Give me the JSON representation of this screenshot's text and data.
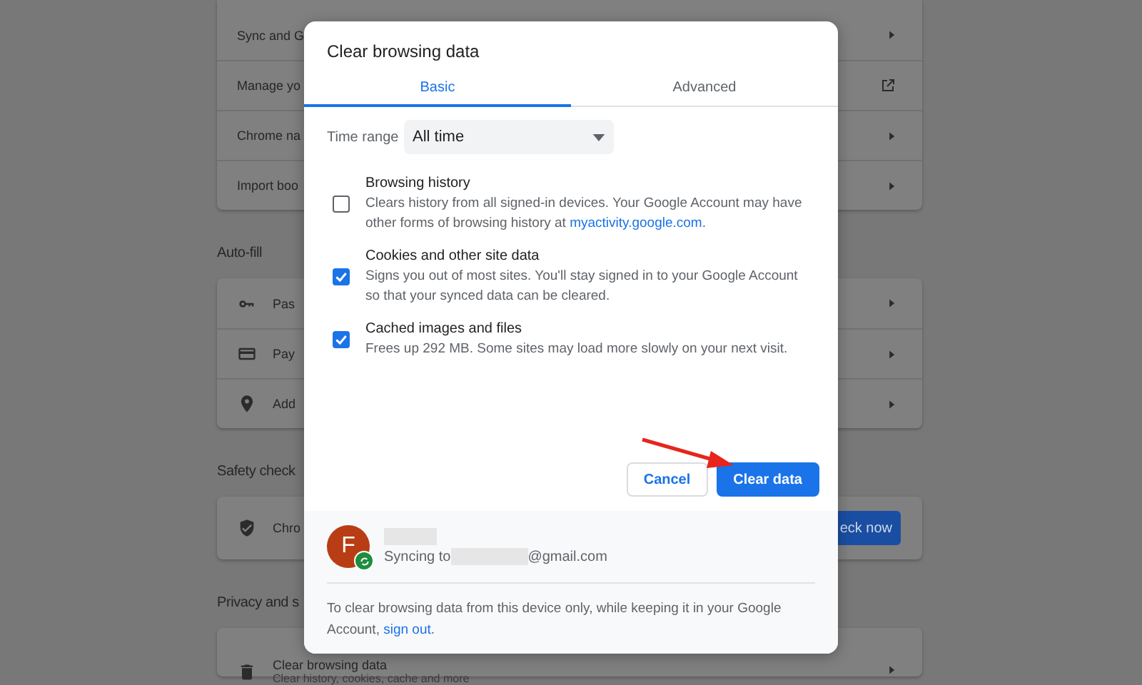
{
  "settings_page": {
    "sections": [
      {
        "rows": [
          {
            "label": "Sync and G"
          },
          {
            "label": "Manage yo"
          },
          {
            "label": "Chrome na"
          },
          {
            "label": "Import boo"
          }
        ]
      },
      {
        "heading": "Auto-fill",
        "rows": [
          {
            "label": "Pas"
          },
          {
            "label": "Pay"
          },
          {
            "label": "Add"
          }
        ]
      },
      {
        "heading": "Safety check",
        "rows": [
          {
            "label": "Chro",
            "button": "eck now"
          }
        ]
      },
      {
        "heading": "Privacy and s",
        "rows": [
          {
            "label": "Clear browsing data",
            "sublabel": "Clear history, cookies, cache and more"
          }
        ]
      }
    ]
  },
  "dialog": {
    "title": "Clear browsing data",
    "tabs": [
      {
        "label": "Basic",
        "selected": true
      },
      {
        "label": "Advanced",
        "selected": false
      }
    ],
    "time_range": {
      "label": "Time range",
      "value": "All time"
    },
    "options": [
      {
        "title": "Browsing history",
        "checked": false,
        "description": "Clears history from all signed-in devices. Your Google Account may have other forms of browsing history at ",
        "link": "myactivity.google.com",
        "description_end": "."
      },
      {
        "title": "Cookies and other site data",
        "checked": true,
        "description": "Signs you out of most sites. You'll stay signed in to your Google Account so that your synced data can be cleared."
      },
      {
        "title": "Cached images and files",
        "checked": true,
        "description": "Frees up 292 MB. Some sites may load more slowly on your next visit."
      }
    ],
    "buttons": [
      {
        "label": "Cancel",
        "kind": "secondary"
      },
      {
        "label": "Clear data",
        "kind": "primary"
      }
    ],
    "account": {
      "avatar_letter": "F",
      "sync_prefix": "Syncing to",
      "email_suffix": "@gmail.com"
    },
    "footer_note": {
      "text": "To clear browsing data from this device only, while keeping it in your Google Account, ",
      "link": "sign out",
      "text_end": "."
    }
  }
}
